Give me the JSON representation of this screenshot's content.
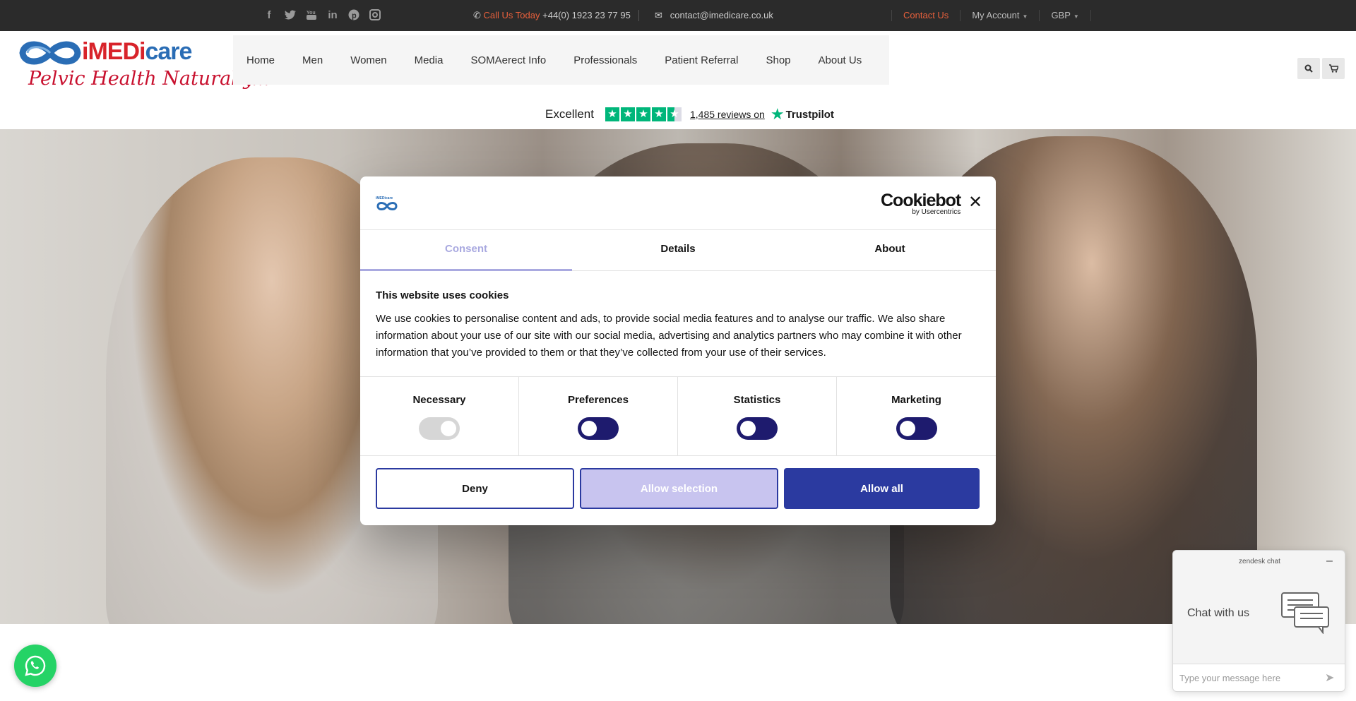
{
  "topbar": {
    "social_icons": [
      "facebook-icon",
      "twitter-icon",
      "youtube-icon",
      "linkedin-icon",
      "pinterest-icon",
      "instagram-icon"
    ],
    "phone_label": "Call Us Today",
    "phone_number": "+44(0) 1923 23 77 95",
    "email": "contact@imedicare.co.uk",
    "contact_us": "Contact Us",
    "my_account": "My Account",
    "currency": "GBP",
    "accent_color": "#e8603c"
  },
  "logo": {
    "brand_prefix": "iMEDi",
    "brand_suffix": "care",
    "tagline": "Pelvic Health Naturally..."
  },
  "nav": {
    "items": [
      "Home",
      "Men",
      "Women",
      "Media",
      "SOMAerect Info",
      "Professionals",
      "Patient Referral",
      "Shop",
      "About Us"
    ]
  },
  "trustpilot": {
    "rating_text": "Excellent",
    "reviews": "1,485 reviews on",
    "brand": "Trustpilot",
    "stars": 4.5,
    "color": "#00b67a"
  },
  "cookie": {
    "brand": "Cookiebot",
    "brand_sub": "by Usercentrics",
    "tabs": [
      "Consent",
      "Details",
      "About"
    ],
    "title": "This website uses cookies",
    "text": "We use cookies to personalise content and ads, to provide social media features and to analyse our traffic. We also share information about your use of our site with our social media, advertising and analytics partners who may combine it with other information that you’ve provided to them or that they’ve collected from your use of their services.",
    "toggles": [
      {
        "label": "Necessary",
        "state": "on-disabled"
      },
      {
        "label": "Preferences",
        "state": "off"
      },
      {
        "label": "Statistics",
        "state": "off"
      },
      {
        "label": "Marketing",
        "state": "off"
      }
    ],
    "buttons": {
      "deny": "Deny",
      "allow_selection": "Allow selection",
      "allow_all": "Allow all"
    },
    "primary_color": "#2b3aa0"
  },
  "zendesk": {
    "label": "zendesk chat",
    "minimize": "–",
    "chat_text": "Chat with us",
    "placeholder": "Type your message here"
  },
  "whatsapp": {
    "color": "#25d366"
  }
}
